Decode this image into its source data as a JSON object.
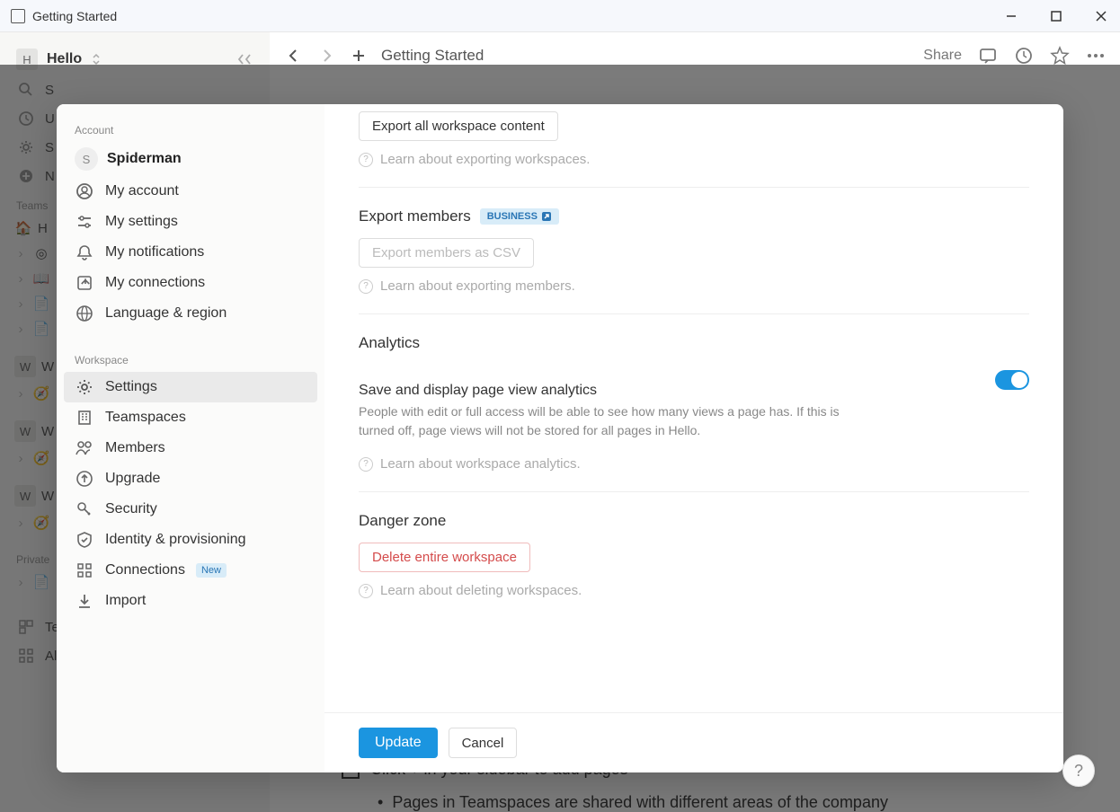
{
  "window": {
    "title": "Getting Started"
  },
  "bg": {
    "workspace_letter": "H",
    "workspace_name": "Hello",
    "quick": [
      "S",
      "U",
      "S",
      "N"
    ],
    "section_teamspaces": "Teams",
    "items": [
      "H",
      "",
      "",
      "",
      ""
    ],
    "w_items": [
      "W",
      "",
      "W",
      "",
      "W",
      ""
    ],
    "section_private": "Private",
    "templates": "Templates",
    "all_teamspaces": "All teamspaces",
    "breadcrumb": "Getting Started",
    "share": "Share",
    "page_checkbox": "Click + in your sidebar to add pages",
    "page_bullet": "Pages in Teamspaces are shared with different areas of the company"
  },
  "modal": {
    "sidebar": {
      "section_account": "Account",
      "profile_letter": "S",
      "profile_name": "Spiderman",
      "items_account": [
        {
          "label": "My account"
        },
        {
          "label": "My settings"
        },
        {
          "label": "My notifications"
        },
        {
          "label": "My connections"
        },
        {
          "label": "Language & region"
        }
      ],
      "section_workspace": "Workspace",
      "items_workspace": [
        {
          "label": "Settings",
          "active": true
        },
        {
          "label": "Teamspaces"
        },
        {
          "label": "Members"
        },
        {
          "label": "Upgrade"
        },
        {
          "label": "Security"
        },
        {
          "label": "Identity & provisioning"
        },
        {
          "label": "Connections",
          "badge": "New"
        },
        {
          "label": "Import"
        }
      ]
    },
    "content": {
      "export_all_btn": "Export all workspace content",
      "learn_export": "Learn about exporting workspaces.",
      "export_members_heading": "Export members",
      "business_badge": "BUSINESS",
      "export_members_btn": "Export members as CSV",
      "learn_members": "Learn about exporting members.",
      "analytics_heading": "Analytics",
      "analytics_title": "Save and display page view analytics",
      "analytics_desc": "People with edit or full access will be able to see how many views a page has. If this is turned off, page views will not be stored for all pages in Hello.",
      "learn_analytics": "Learn about workspace analytics.",
      "danger_heading": "Danger zone",
      "delete_btn": "Delete entire workspace",
      "learn_delete": "Learn about deleting workspaces.",
      "update_btn": "Update",
      "cancel_btn": "Cancel"
    }
  },
  "help_fab": "?"
}
